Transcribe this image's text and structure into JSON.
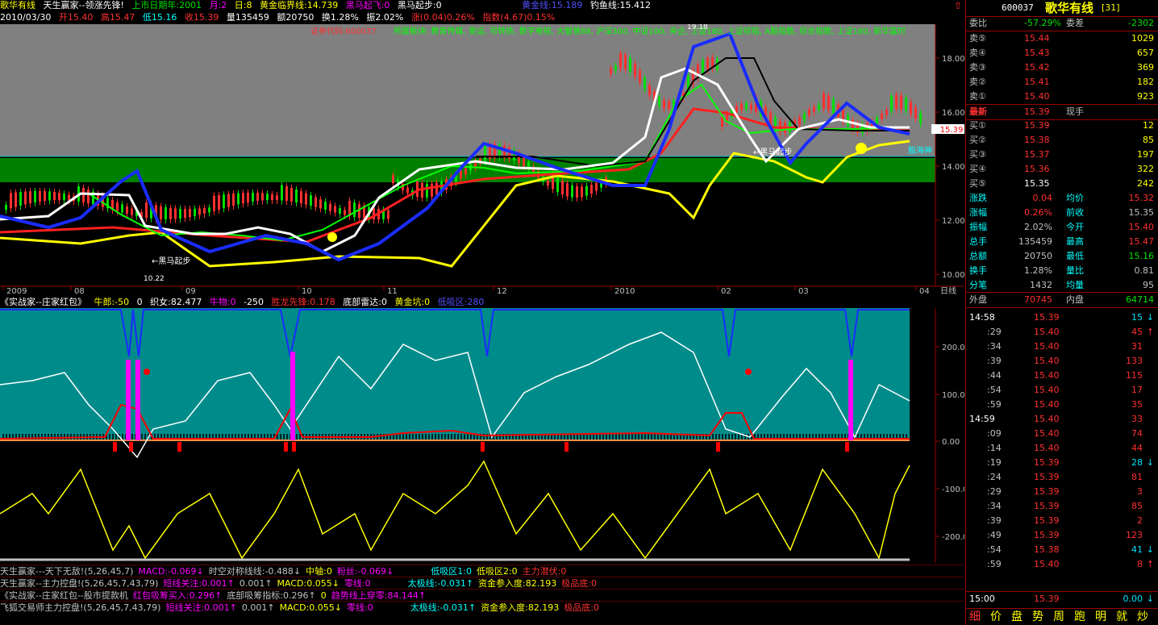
{
  "title_bar": {
    "stock_name": "歌华有线",
    "indicator_name": "天生赢家--领涨先锋!",
    "list_year_label": "上市日期年:2001",
    "month_label": "月:2",
    "day_label": "日:8",
    "golden_line": "黄金临界线:14.739",
    "horse_fly": "黑马起飞:0",
    "horse_start": "黑马起步:0",
    "gold_line_val": "黄金线:15.189",
    "fishing_line": "钓鱼线:15.412"
  },
  "info_bar": {
    "date": "2010/03/30",
    "open": "开15.40",
    "high": "高15.47",
    "low": "低15.16",
    "close": "收15.39",
    "volume": "量135459",
    "amount": "额20750",
    "turnover": "换1.28%",
    "amplitude": "振2.02%",
    "change": "涨(0.04)0.26%",
    "index": "指数(4.67)0.15%"
  },
  "main_chart": {
    "code_label": "证券代码:600037",
    "sector_label": "所属板块: 教育传媒, 奥运, 可转债, 数字电视, 大智慧88, 沪深300, 中证100, 央企, 上证180, 上证综指, A股指数, 综合指数, 上证180, 新华富时",
    "price_badge": "15.39",
    "price_ticks": [
      "18.00",
      "16.00",
      "14.00",
      "12.00",
      "10.00"
    ],
    "date_ticks": [
      "2009",
      "08",
      "09",
      "10",
      "11",
      "12",
      "2010",
      "02",
      "03",
      "04"
    ],
    "period_label": "日线",
    "annot_peak": "19.18",
    "annot_low": "10.22",
    "annot_horse1": "←黑马起步",
    "annot_horse2": "←黑马起步",
    "annot_right": "股海神"
  },
  "indicator_bar": {
    "name": "《实战家--庄家红包》",
    "cowherd": "牛郎:-50",
    "zero": "0",
    "weaver": "织女:82.477",
    "cow": "牛物:0",
    "neg": "-250",
    "dragon": "胜龙先锋:0.178",
    "radar": "底部雷达:0",
    "gold_pit": "黄金坑:0",
    "low_zone": "低吸区:280"
  },
  "sub_chart": {
    "ticks": [
      "200.00",
      "100.00",
      "0.00",
      "-100.0",
      "-200.0"
    ]
  },
  "bottom_rows": [
    {
      "a": "天生赢家---天下无敌!(5,26,45,7)",
      "b": "MACD:-0.069↓",
      "c": "时空对称线线:-0.488↓",
      "d": "中轴:0",
      "e": "粉丝:-0.069↓",
      "f": "低吸区1:0",
      "g": "低吸区2:0",
      "h": "主力潜伏:0"
    },
    {
      "a": "天生赢家--主力控盘!(5,26,45,7,43,79)",
      "b": "短线关注:0.001↑",
      "c": "0.001↑",
      "d": "MACD:0.055↓",
      "e": "零线:0",
      "f": "太极线:-0.031↑",
      "g": "资金参入度:82.193",
      "h": "极品底:0"
    },
    {
      "a": "《实战家--庄家红包--股市提款机",
      "b": "红包吸筹买入:0.296↑",
      "c": "底部吸筹指标:0.296↑",
      "d": "0",
      "e": "趋势线上穿零:84.144↑",
      "f": "",
      "g": "",
      "": ""
    },
    {
      "a": "飞狐交易师主力控盘!(5,26,45,7,43,79)",
      "b": "短线关注:0.001↑",
      "c": "0.001↑",
      "d": "MACD:0.055↓",
      "e": "零线:0",
      "f": "太极线:-0.031↑",
      "g": "资金参入度:82.193",
      "h": "极品底:0"
    }
  ],
  "right_panel": {
    "code": "600037",
    "name": "歌华有线",
    "count": "[31]",
    "weibi_label": "委比",
    "weibi_val": "-57.29%",
    "weicha_label": "委差",
    "weicha_val": "-2302",
    "sells": [
      {
        "label": "卖⑤",
        "price": "15.44",
        "vol": "1029"
      },
      {
        "label": "卖④",
        "price": "15.43",
        "vol": "657"
      },
      {
        "label": "卖③",
        "price": "15.42",
        "vol": "369"
      },
      {
        "label": "卖②",
        "price": "15.41",
        "vol": "182"
      },
      {
        "label": "卖①",
        "price": "15.40",
        "vol": "923"
      }
    ],
    "latest_label": "最新",
    "latest_val": "15.39",
    "now_label": "现手",
    "buys": [
      {
        "label": "买①",
        "price": "15.39",
        "vol": "12"
      },
      {
        "label": "买②",
        "price": "15.38",
        "vol": "85"
      },
      {
        "label": "买③",
        "price": "15.37",
        "vol": "197"
      },
      {
        "label": "买④",
        "price": "15.36",
        "vol": "322"
      },
      {
        "label": "买⑤",
        "price": "15.35",
        "vol": "242"
      }
    ],
    "stats": [
      {
        "l1": "涨跌",
        "v1": "0.04",
        "l2": "均价",
        "v2": "15.32"
      },
      {
        "l1": "涨幅",
        "v1": "0.26%",
        "l2": "前收",
        "v2": "15.35"
      },
      {
        "l1": "振幅",
        "v1": "2.02%",
        "l2": "今开",
        "v2": "15.40"
      },
      {
        "l1": "总手",
        "v1": "135459",
        "l2": "最高",
        "v2": "15.47"
      },
      {
        "l1": "总额",
        "v1": "20750",
        "l2": "最低",
        "v2": "15.16"
      },
      {
        "l1": "换手",
        "v1": "1.28%",
        "l2": "量比",
        "v2": "0.81"
      },
      {
        "l1": "分笔",
        "v1": "1432",
        "l2": "均量",
        "v2": "95"
      }
    ],
    "outer_label": "外盘",
    "outer_val": "70745",
    "inner_label": "内盘",
    "inner_val": "64714",
    "ticks": [
      {
        "t": "14:58",
        "p": "15.39",
        "v": "15",
        "d": "↓"
      },
      {
        "t": ":29",
        "p": "15.40",
        "v": "45",
        "d": "↑"
      },
      {
        "t": ":34",
        "p": "15.40",
        "v": "31",
        "d": ""
      },
      {
        "t": ":39",
        "p": "15.40",
        "v": "133",
        "d": ""
      },
      {
        "t": ":44",
        "p": "15.40",
        "v": "115",
        "d": ""
      },
      {
        "t": ":54",
        "p": "15.40",
        "v": "17",
        "d": ""
      },
      {
        "t": ":59",
        "p": "15.40",
        "v": "35",
        "d": ""
      },
      {
        "t": "14:59",
        "p": "15.40",
        "v": "33",
        "d": ""
      },
      {
        "t": ":09",
        "p": "15.40",
        "v": "74",
        "d": ""
      },
      {
        "t": ":14",
        "p": "15.40",
        "v": "44",
        "d": ""
      },
      {
        "t": ":19",
        "p": "15.39",
        "v": "28",
        "d": "↓"
      },
      {
        "t": ":24",
        "p": "15.39",
        "v": "81",
        "d": ""
      },
      {
        "t": ":29",
        "p": "15.39",
        "v": "3",
        "d": ""
      },
      {
        "t": ":34",
        "p": "15.39",
        "v": "85",
        "d": ""
      },
      {
        "t": ":39",
        "p": "15.39",
        "v": "2",
        "d": ""
      },
      {
        "t": ":49",
        "p": "15.39",
        "v": "123",
        "d": ""
      },
      {
        "t": ":54",
        "p": "15.38",
        "v": "41",
        "d": "↓"
      },
      {
        "t": ":59",
        "p": "15.40",
        "v": "8",
        "d": "↑"
      },
      {
        "t": "15:00",
        "p": "15.39",
        "v": "0.00",
        "d": "↓"
      }
    ],
    "footer_tabs": [
      "细",
      "价",
      "盘",
      "势",
      "周",
      "跑",
      "明",
      "就",
      "炒"
    ]
  },
  "colors": {
    "up": "#ff3030",
    "down": "#00e000",
    "gold": "#ffff00",
    "teal": "#008b8b",
    "green_band": "#008000",
    "grey_band": "#808080"
  }
}
